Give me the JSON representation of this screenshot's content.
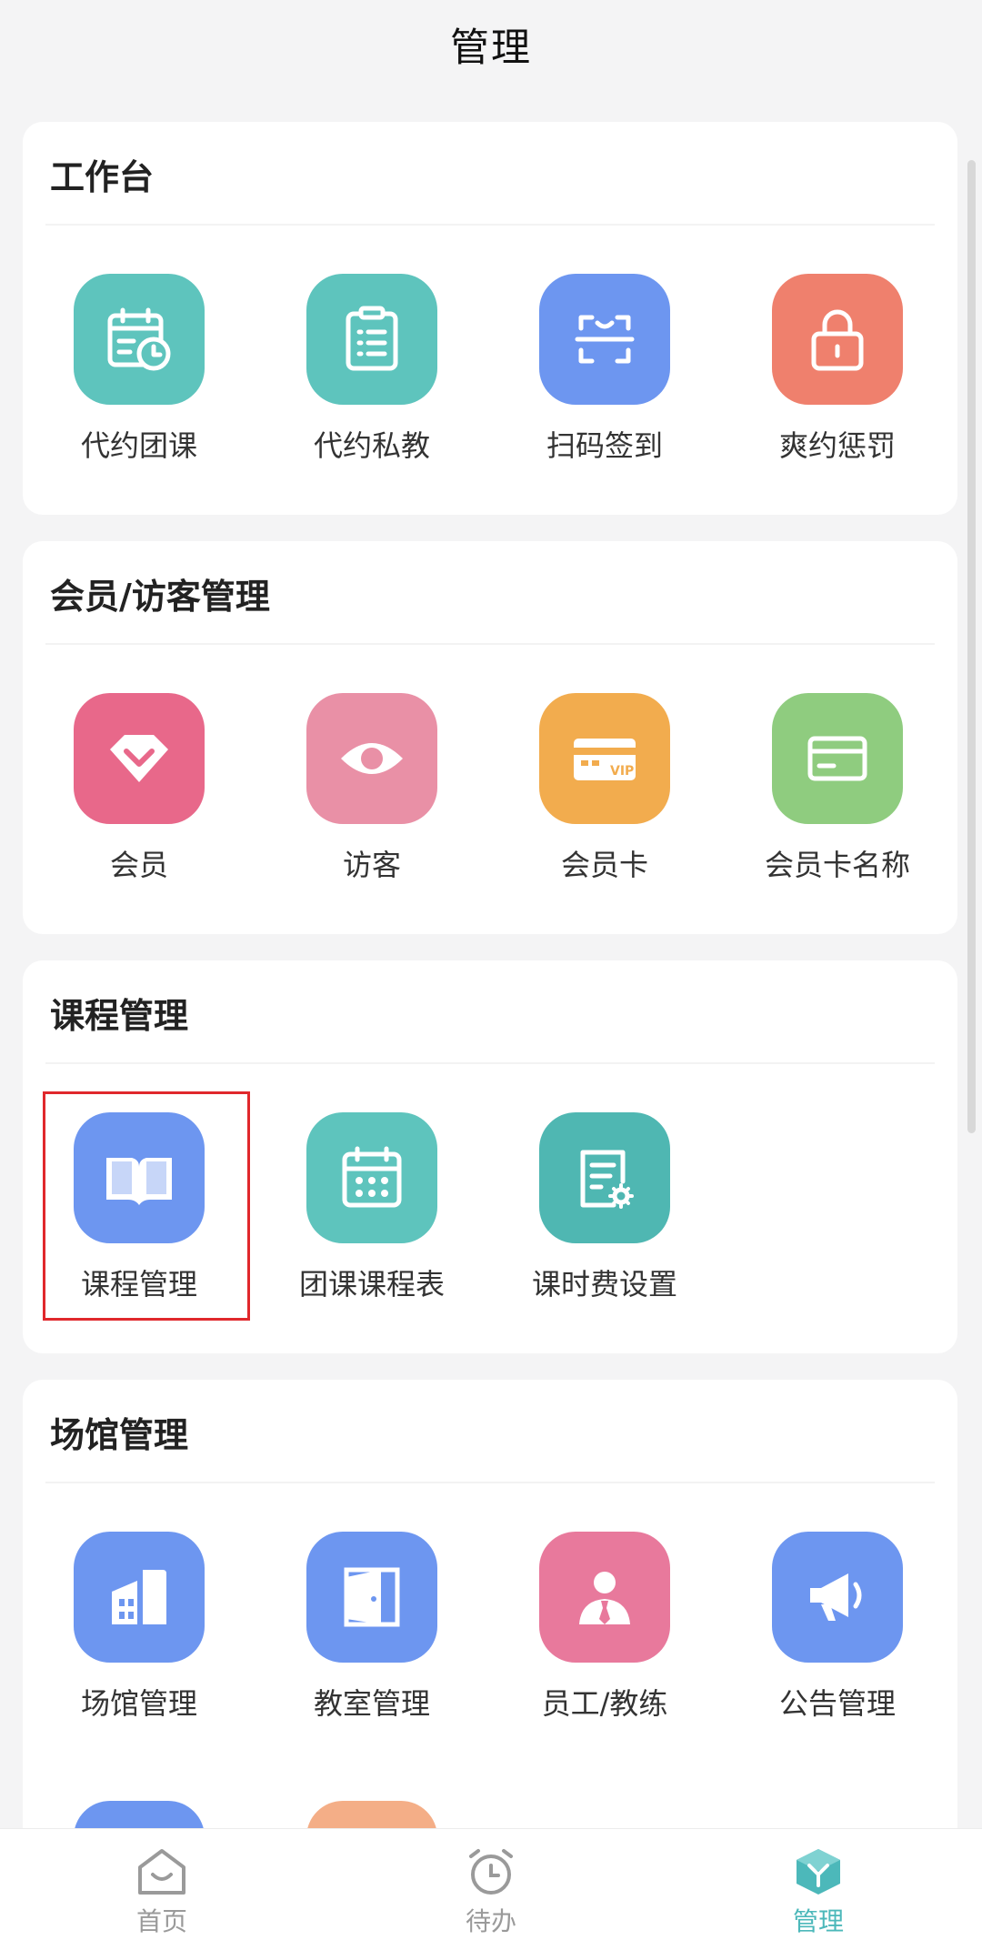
{
  "header": {
    "title": "管理"
  },
  "sections": [
    {
      "title": "工作台",
      "items": [
        {
          "label": "代约团课",
          "icon": "calendar-clock-icon",
          "color": "#5ec4bd"
        },
        {
          "label": "代约私教",
          "icon": "clipboard-list-icon",
          "color": "#5ec4bd"
        },
        {
          "label": "扫码签到",
          "icon": "scan-icon",
          "color": "#6d96f0"
        },
        {
          "label": "爽约惩罚",
          "icon": "lock-icon",
          "color": "#ef806d"
        }
      ]
    },
    {
      "title": "会员/访客管理",
      "items": [
        {
          "label": "会员",
          "icon": "diamond-icon",
          "color": "#e8688a"
        },
        {
          "label": "访客",
          "icon": "eye-icon",
          "color": "#e990a6"
        },
        {
          "label": "会员卡",
          "icon": "vip-card-icon",
          "color": "#f2ac4e",
          "badge": "VIP"
        },
        {
          "label": "会员卡名称",
          "icon": "card-icon",
          "color": "#8fcc7f"
        }
      ]
    },
    {
      "title": "课程管理",
      "items": [
        {
          "label": "课程管理",
          "icon": "book-icon",
          "color": "#6d96f0"
        },
        {
          "label": "团课课程表",
          "icon": "calendar-grid-icon",
          "color": "#5ec4bd"
        },
        {
          "label": "课时费设置",
          "icon": "document-gear-icon",
          "color": "#4fb7b2"
        }
      ]
    },
    {
      "title": "场馆管理",
      "items": [
        {
          "label": "场馆管理",
          "icon": "building-icon",
          "color": "#6d96f0"
        },
        {
          "label": "教室管理",
          "icon": "door-icon",
          "color": "#6d96f0"
        },
        {
          "label": "员工/教练",
          "icon": "staff-icon",
          "color": "#e8799c"
        },
        {
          "label": "公告管理",
          "icon": "megaphone-icon",
          "color": "#6d96f0"
        },
        {
          "label": "",
          "icon": "partial-icon",
          "color": "#6d96f0"
        },
        {
          "label": "",
          "icon": "partial-icon",
          "color": "#f4ae87"
        }
      ]
    }
  ],
  "tabbar": [
    {
      "label": "首页",
      "icon": "home-icon"
    },
    {
      "label": "待办",
      "icon": "alarm-clock-icon"
    },
    {
      "label": "管理",
      "icon": "management-icon",
      "active": true
    }
  ],
  "colors": {
    "active_tab": "#4cb8ba",
    "highlight": "#e0282c"
  }
}
